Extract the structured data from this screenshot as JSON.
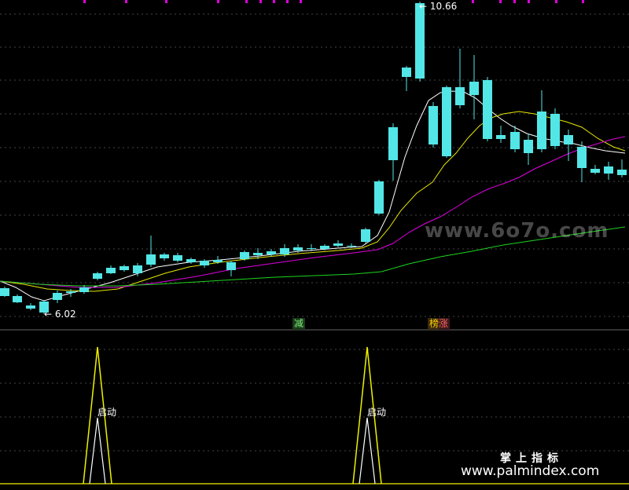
{
  "main": {
    "high_label": "10.66",
    "low_label": "6.02",
    "marker_reduce": "减",
    "marker_rank": "榜",
    "marker_limit": "涨",
    "watermark_url": "www.6o7o.com"
  },
  "indicator": {
    "signal_label": "启动",
    "brand": "掌上指标",
    "brand_url": "www.palmindex.com"
  },
  "colors": {
    "up": "#ff3b3b",
    "down": "#53e6e6",
    "ma_white": "#ffffff",
    "ma_yellow": "#e6e600",
    "ma_magenta": "#e000e0",
    "ma_green": "#1ed41e",
    "grid": "#444444",
    "top_ticks": "#e000e0",
    "signal_line": "#f0f000"
  }
}
